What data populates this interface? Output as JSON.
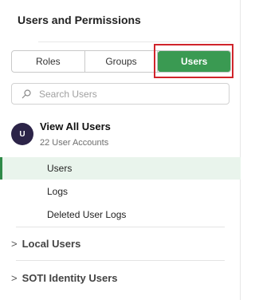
{
  "panel": {
    "title": "Users and Permissions"
  },
  "tabs": [
    {
      "label": "Roles",
      "active": false
    },
    {
      "label": "Groups",
      "active": false
    },
    {
      "label": "Users",
      "active": true
    }
  ],
  "search": {
    "placeholder": "Search Users"
  },
  "account": {
    "avatar_initial": "U",
    "title": "View All Users",
    "subtitle": "22 User Accounts"
  },
  "nav": {
    "users": "Users",
    "logs": "Logs",
    "deleted_user_logs": "Deleted User Logs"
  },
  "groups": {
    "local_users": "Local Users",
    "soti_identity_users": "SOTI Identity Users",
    "chevron": ">"
  },
  "colors": {
    "accent": "#3a9a52",
    "active_bg": "#e9f4ec",
    "avatar_bg": "#2c2448",
    "highlight": "#d0242b"
  },
  "icons": {
    "search": "search-icon",
    "chevron": "chevron-right-icon"
  }
}
